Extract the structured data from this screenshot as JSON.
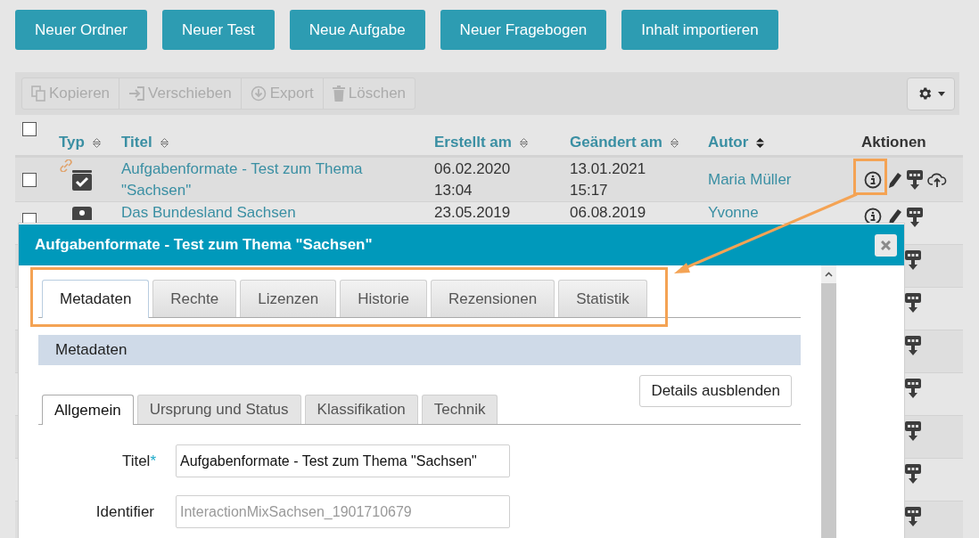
{
  "top_buttons": [
    "Neuer Ordner",
    "Neuer Test",
    "Neue Aufgabe",
    "Neuer Fragebogen",
    "Inhalt importieren"
  ],
  "actions_bar": {
    "buttons": [
      {
        "label": "Kopieren",
        "kind": "copy",
        "disabled": true
      },
      {
        "label": "Verschieben",
        "kind": "move",
        "disabled": true
      },
      {
        "label": "Export",
        "kind": "export",
        "disabled": true
      },
      {
        "label": "Löschen",
        "kind": "delete",
        "disabled": true
      }
    ]
  },
  "table": {
    "select_all": {
      "checked": false
    },
    "columns": [
      {
        "label": "Typ",
        "sorted": false
      },
      {
        "label": "Titel",
        "sorted": false
      },
      {
        "label": "Erstellt am",
        "sorted": false
      },
      {
        "label": "Geändert am",
        "sorted": false
      },
      {
        "label": "Autor",
        "sorted": true
      },
      {
        "label": "Aktionen"
      }
    ],
    "rows": [
      {
        "checked": false,
        "kind": "test",
        "linked": true,
        "title": "Aufgabenformate - Test zum Thema \"Sachsen\"",
        "created": "06.02.2020 13:04",
        "changed": "13.01.2021 15:17",
        "author": "Maria Müller",
        "actions": [
          {
            "kind": "info"
          },
          {
            "kind": "edit"
          },
          {
            "kind": "pdf"
          },
          {
            "kind": "upload"
          }
        ]
      },
      {
        "checked": false,
        "kind": "task",
        "linked": false,
        "title": "Das Bundesland Sachsen",
        "created": "23.05.2019",
        "changed": "06.08.2019",
        "author": "Yvonne",
        "actions": [
          {
            "kind": "info"
          },
          {
            "kind": "edit"
          },
          {
            "kind": "pdf"
          }
        ]
      },
      {
        "actions": [
          {
            "kind": "pdf"
          }
        ]
      },
      {
        "actions": [
          {
            "kind": "pdf"
          }
        ]
      },
      {
        "actions": [
          {
            "kind": "pdf"
          }
        ]
      },
      {
        "actions": [
          {
            "kind": "pdf"
          }
        ]
      },
      {
        "actions": [
          {
            "kind": "pdf"
          }
        ]
      },
      {
        "actions": [
          {
            "kind": "pdf"
          }
        ]
      },
      {
        "actions": [
          {
            "kind": "pdf"
          }
        ]
      }
    ]
  },
  "dialog": {
    "title": "Aufgabenformate - Test zum Thema \"Sachsen\"",
    "tabs": [
      {
        "label": "Metadaten",
        "selected": true
      },
      {
        "label": "Rechte",
        "selected": false
      },
      {
        "label": "Lizenzen",
        "selected": false
      },
      {
        "label": "Historie",
        "selected": false
      },
      {
        "label": "Rezensionen",
        "selected": false
      },
      {
        "label": "Statistik",
        "selected": false
      }
    ],
    "section_title": "Metadaten",
    "details_button": "Details ausblenden",
    "subtabs": [
      {
        "label": "Allgemein",
        "selected": true
      },
      {
        "label": "Ursprung und Status",
        "selected": false
      },
      {
        "label": "Klassifikation",
        "selected": false
      },
      {
        "label": "Technik",
        "selected": false
      }
    ],
    "fields": [
      {
        "label": "Titel",
        "required_mark": "*",
        "value": "Aufgabenformate - Test zum Thema \"Sachsen\"",
        "disabled": false
      },
      {
        "label": "Identifier",
        "value": "InteractionMixSachsen_1901710679",
        "disabled": true
      }
    ]
  }
}
